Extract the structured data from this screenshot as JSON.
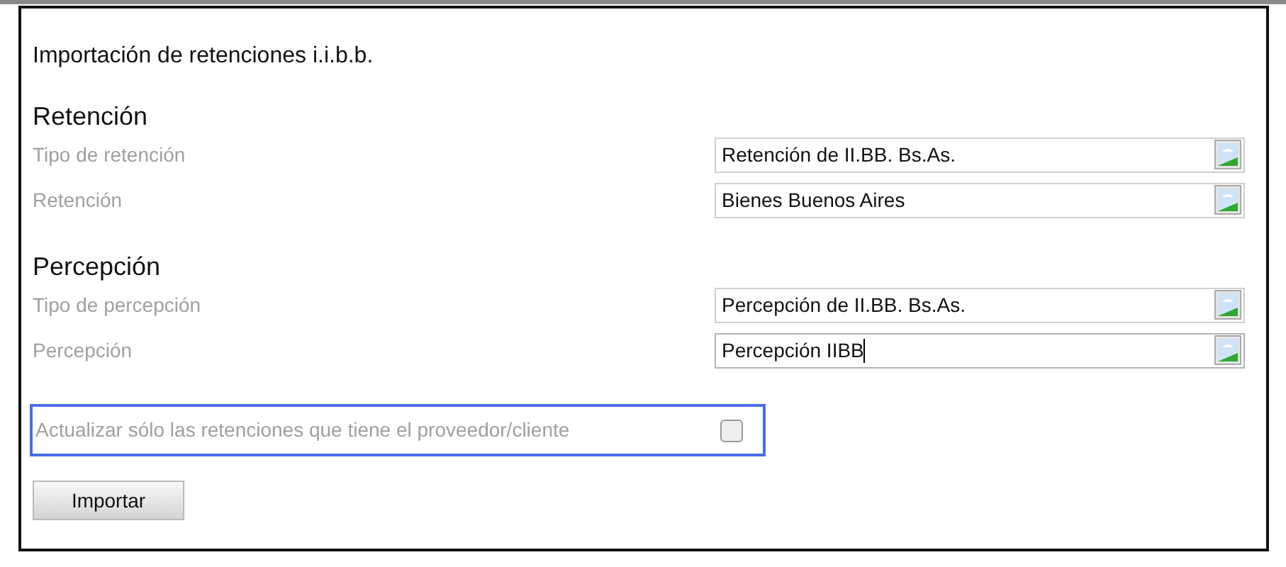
{
  "title": "Importación de retenciones i.i.b.b.",
  "sections": [
    {
      "heading": "Retención",
      "fields": [
        {
          "label": "Tipo de retención",
          "value": "Retención de II.BB. Bs.As.",
          "focused": false
        },
        {
          "label": "Retención",
          "value": "Bienes Buenos Aires",
          "focused": false
        }
      ]
    },
    {
      "heading": "Percepción",
      "fields": [
        {
          "label": "Tipo de percepción",
          "value": "Percepción de II.BB. Bs.As.",
          "focused": false
        },
        {
          "label": "Percepción",
          "value": "Percepción IIBB",
          "focused": true
        }
      ]
    }
  ],
  "option": {
    "label": "Actualizar sólo las retenciones que tiene el proveedor/cliente",
    "checked": false
  },
  "button": "Importar"
}
